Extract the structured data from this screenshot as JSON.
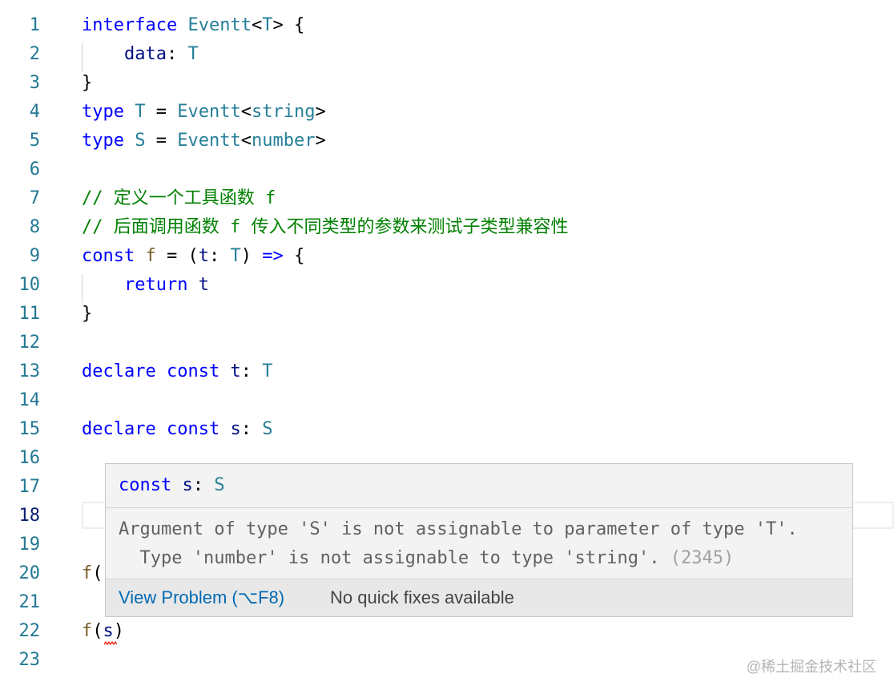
{
  "editor": {
    "lines": [
      {
        "num": "1",
        "tokens": [
          {
            "t": "interface",
            "c": "kw"
          },
          {
            "t": " ",
            "c": "pl"
          },
          {
            "t": "Eventt",
            "c": "ty"
          },
          {
            "t": "<",
            "c": "pl"
          },
          {
            "t": "T",
            "c": "ty"
          },
          {
            "t": "> {",
            "c": "pl"
          }
        ]
      },
      {
        "num": "2",
        "tokens": [
          {
            "t": "    ",
            "c": "pl"
          },
          {
            "t": "data",
            "c": "vr"
          },
          {
            "t": ": ",
            "c": "pl"
          },
          {
            "t": "T",
            "c": "ty"
          }
        ]
      },
      {
        "num": "3",
        "tokens": [
          {
            "t": "}",
            "c": "pl"
          }
        ]
      },
      {
        "num": "4",
        "tokens": [
          {
            "t": "type",
            "c": "kw"
          },
          {
            "t": " ",
            "c": "pl"
          },
          {
            "t": "T",
            "c": "ty"
          },
          {
            "t": " = ",
            "c": "pl"
          },
          {
            "t": "Eventt",
            "c": "ty"
          },
          {
            "t": "<",
            "c": "pl"
          },
          {
            "t": "string",
            "c": "ty"
          },
          {
            "t": ">",
            "c": "pl"
          }
        ]
      },
      {
        "num": "5",
        "tokens": [
          {
            "t": "type",
            "c": "kw"
          },
          {
            "t": " ",
            "c": "pl"
          },
          {
            "t": "S",
            "c": "ty"
          },
          {
            "t": " = ",
            "c": "pl"
          },
          {
            "t": "Eventt",
            "c": "ty"
          },
          {
            "t": "<",
            "c": "pl"
          },
          {
            "t": "number",
            "c": "ty"
          },
          {
            "t": ">",
            "c": "pl"
          }
        ]
      },
      {
        "num": "6",
        "tokens": []
      },
      {
        "num": "7",
        "tokens": [
          {
            "t": "// 定义一个工具函数 f",
            "c": "cm"
          }
        ]
      },
      {
        "num": "8",
        "tokens": [
          {
            "t": "// 后面调用函数 f 传入不同类型的参数来测试子类型兼容性",
            "c": "cm"
          }
        ]
      },
      {
        "num": "9",
        "tokens": [
          {
            "t": "const",
            "c": "kw"
          },
          {
            "t": " ",
            "c": "pl"
          },
          {
            "t": "f",
            "c": "fn"
          },
          {
            "t": " = (",
            "c": "pl"
          },
          {
            "t": "t",
            "c": "vr"
          },
          {
            "t": ": ",
            "c": "pl"
          },
          {
            "t": "T",
            "c": "ty"
          },
          {
            "t": ") ",
            "c": "pl"
          },
          {
            "t": "=>",
            "c": "kw"
          },
          {
            "t": " {",
            "c": "pl"
          }
        ]
      },
      {
        "num": "10",
        "tokens": [
          {
            "t": "    ",
            "c": "pl"
          },
          {
            "t": "return",
            "c": "kw"
          },
          {
            "t": " ",
            "c": "pl"
          },
          {
            "t": "t",
            "c": "vr"
          }
        ]
      },
      {
        "num": "11",
        "tokens": [
          {
            "t": "}",
            "c": "pl"
          }
        ]
      },
      {
        "num": "12",
        "tokens": []
      },
      {
        "num": "13",
        "tokens": [
          {
            "t": "declare",
            "c": "kw"
          },
          {
            "t": " ",
            "c": "pl"
          },
          {
            "t": "const",
            "c": "kw"
          },
          {
            "t": " ",
            "c": "pl"
          },
          {
            "t": "t",
            "c": "vr"
          },
          {
            "t": ": ",
            "c": "pl"
          },
          {
            "t": "T",
            "c": "ty"
          }
        ]
      },
      {
        "num": "14",
        "tokens": []
      },
      {
        "num": "15",
        "tokens": [
          {
            "t": "declare",
            "c": "kw"
          },
          {
            "t": " ",
            "c": "pl"
          },
          {
            "t": "const",
            "c": "kw"
          },
          {
            "t": " ",
            "c": "pl"
          },
          {
            "t": "s",
            "c": "vr"
          },
          {
            "t": ": ",
            "c": "pl"
          },
          {
            "t": "S",
            "c": "ty"
          }
        ]
      },
      {
        "num": "16",
        "tokens": []
      },
      {
        "num": "17",
        "tokens": []
      },
      {
        "num": "18",
        "tokens": []
      },
      {
        "num": "19",
        "tokens": []
      },
      {
        "num": "20",
        "tokens": [
          {
            "t": "f",
            "c": "fn"
          },
          {
            "t": "(",
            "c": "pl"
          }
        ]
      },
      {
        "num": "21",
        "tokens": []
      },
      {
        "num": "22",
        "tokens": [
          {
            "t": "f",
            "c": "fn"
          },
          {
            "t": "(",
            "c": "pl"
          },
          {
            "t": "s",
            "c": "vr"
          },
          {
            "t": ")",
            "c": "pl"
          }
        ]
      },
      {
        "num": "23",
        "tokens": []
      }
    ],
    "active_line": "18"
  },
  "hover": {
    "signature": [
      {
        "t": "const",
        "c": "kw"
      },
      {
        "t": " ",
        "c": "pl"
      },
      {
        "t": "s",
        "c": "vr"
      },
      {
        "t": ": ",
        "c": "pl"
      },
      {
        "t": "S",
        "c": "ty"
      }
    ],
    "message_line1": "Argument of type 'S' is not assignable to parameter of type 'T'.",
    "message_line2": "  Type 'number' is not assignable to type 'string'.",
    "error_code": "(2345)",
    "view_problem_label": "View Problem (⌥F8)",
    "no_quick_fixes_label": "No quick fixes available"
  },
  "watermark": "@稀土掘金技术社区",
  "colors": {
    "keyword": "#0000ff",
    "type": "#267f99",
    "comment": "#008000",
    "function": "#795e26",
    "variable": "#001080",
    "line_number": "#237893",
    "error_squiggle": "#e51400",
    "link": "#006ab1"
  }
}
